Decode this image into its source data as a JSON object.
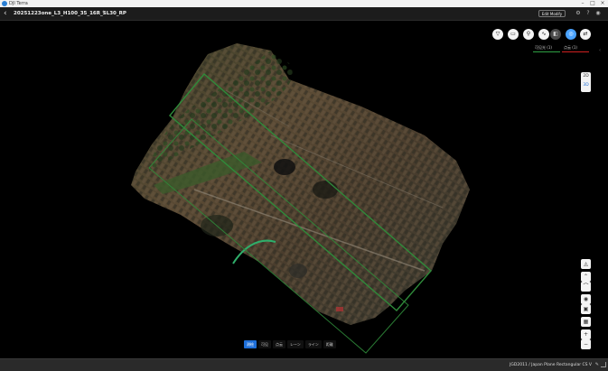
{
  "app": {
    "name": "DJI Terra"
  },
  "header": {
    "project_title": "20251223one_L3_H100_35_16R_SL30_RP",
    "edit_label": "Edit Modify"
  },
  "layers": {
    "tab1": "可见光 (1)",
    "tab2": "点云 (1)"
  },
  "side_panel": {
    "mode_2d": "2D",
    "mode_3d": "3D"
  },
  "bottom_tabs": [
    "测绘",
    "可见",
    "点云",
    "レーン",
    "ライン",
    "距離"
  ],
  "status": {
    "crs": "JGD2011 / Japan Plane Rectangular CS V"
  },
  "colors": {
    "accent": "#1e6fd9",
    "boundary": "#2f8a3a",
    "layer_green": "#2ea043",
    "layer_red": "#d02020"
  },
  "icons": [
    "funnel-icon",
    "annotation-icon",
    "pin-icon",
    "route-icon",
    "layers-icon",
    "globe-icon",
    "share-icon"
  ]
}
